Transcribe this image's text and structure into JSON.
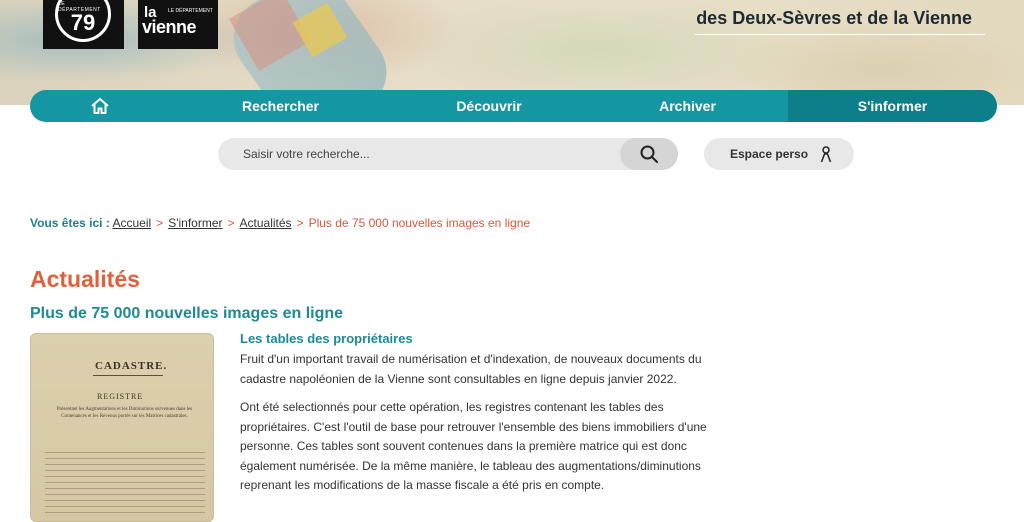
{
  "header": {
    "logo_deux_sevres": {
      "small": "LE DÉPARTEMENT",
      "number": "79"
    },
    "logo_vienne": {
      "la": "la",
      "small": "LE DÉPARTEMENT",
      "name": "vienne"
    },
    "site_title": "des Deux-Sèvres et de la Vienne"
  },
  "nav": {
    "home_icon": "home-icon",
    "items": [
      {
        "label": "Rechercher"
      },
      {
        "label": "Découvrir"
      },
      {
        "label": "Archiver"
      },
      {
        "label": "S'informer"
      }
    ]
  },
  "search": {
    "placeholder": "Saisir votre recherche...",
    "icon": "search-icon"
  },
  "espace_perso": {
    "label": "Espace perso",
    "icon": "user-icon"
  },
  "breadcrumb": {
    "label": "Vous êtes ici :",
    "items": [
      "Accueil",
      "S'informer",
      "Actualités"
    ],
    "current": "Plus de 75 000 nouvelles images en ligne"
  },
  "page": {
    "section_title": "Actualités",
    "article_title": "Plus de 75 000 nouvelles images en ligne",
    "thumbnail": {
      "heading": "CADASTRE.",
      "subheading": "REGISTRE",
      "caption": "Présentant les Augmentations et les Diminutions survenues dans les Contenances et les Revenus portés sur les Matrices cadastrales."
    },
    "subtitle": "Les tables des propriétaires",
    "paragraphs": [
      "Fruit d'un important travail de numérisation et d'indexation, de nouveaux documents du cadastre napoléonien de la Vienne sont consultables en ligne depuis janvier 2022.",
      "Ont été selectionnés pour cette opération, les registres contenant les tables des propriétaires. C'est l'outil de base pour retrouver l'ensemble des biens immobiliers d'une personne. Ces tables sont souvent contenues dans la première matrice qui est donc également numérisée. De la même manière, le tableau des augmentations/diminutions reprenant les modifications de la masse fiscale a été pris en compte."
    ]
  },
  "colors": {
    "nav": "#1497a2",
    "nav_active": "#0d7f8a",
    "accent_orange": "#e0603c",
    "teal_text": "#1e8a97"
  }
}
